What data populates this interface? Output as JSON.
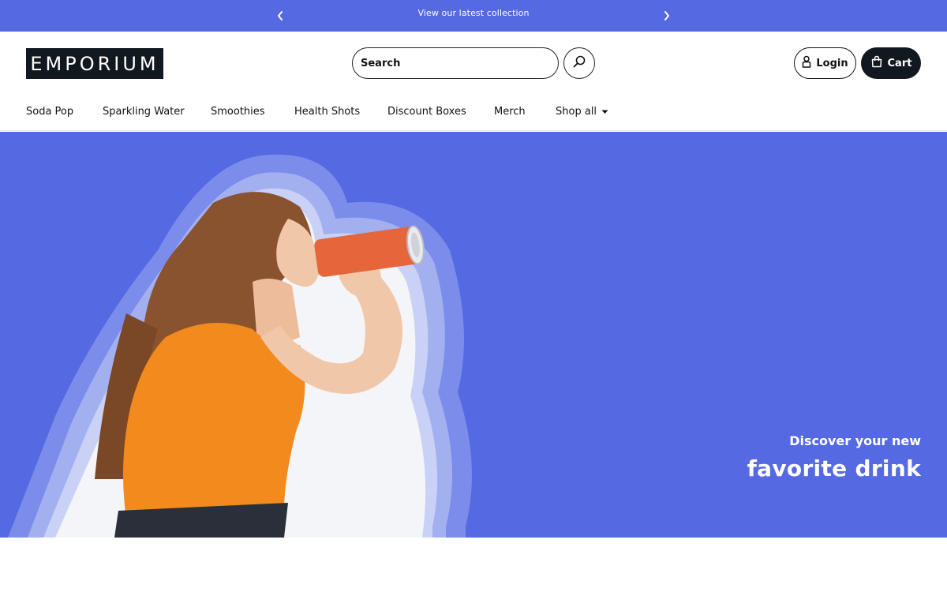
{
  "announcement": {
    "text": "View our latest collection",
    "prev_icon": "chevron-left-icon",
    "next_icon": "chevron-right-icon"
  },
  "header": {
    "logo_text": "EMPORIUM",
    "search": {
      "placeholder": "Search",
      "value": ""
    },
    "search_icon": "search-icon",
    "login_label": "Login",
    "login_icon": "user-icon",
    "cart_label": "Cart",
    "cart_icon": "shopping-bag-icon"
  },
  "nav": {
    "items": [
      {
        "label": "Soda Pop"
      },
      {
        "label": "Sparkling Water"
      },
      {
        "label": "Smoothies"
      },
      {
        "label": "Health Shots"
      },
      {
        "label": "Discount Boxes"
      },
      {
        "label": "Merch"
      },
      {
        "label": "Shop all",
        "icon": "caret-down-icon"
      }
    ]
  },
  "hero": {
    "subtitle": "Discover your new",
    "title": "favorite drink",
    "image_description_icon": "woman-drinking-can-image",
    "colors": {
      "background": "#5469e2",
      "halo_outer": "#7b8cea",
      "halo_mid": "#a3b0f0",
      "halo_inner": "#c9d1f7",
      "shirt": "#f28a1e",
      "can": "#e4663a"
    }
  },
  "colors": {
    "accent": "#5469e2",
    "dark": "#111820"
  }
}
